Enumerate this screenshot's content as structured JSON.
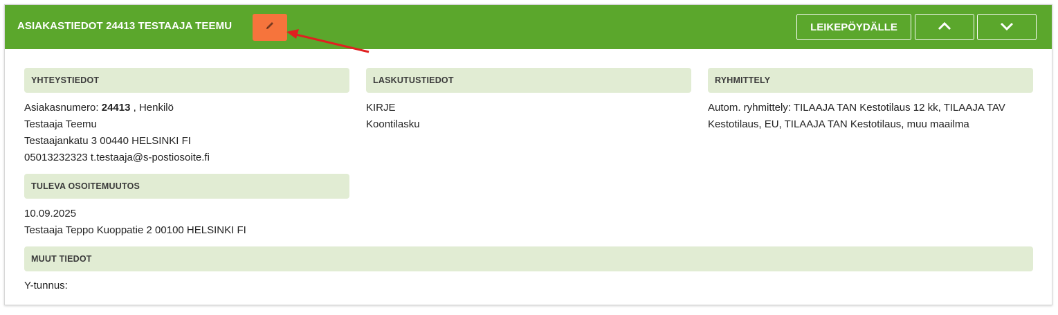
{
  "header": {
    "title": "ASIAKASTIEDOT 24413 TESTAAJA TEEMU",
    "clipboard_label": "LEIKEPÖYDÄLLE",
    "edit_icon": "pencil-icon",
    "up_icon": "chevron-up-icon",
    "down_icon": "chevron-down-icon",
    "color": "#5ba72c",
    "edit_color": "#f6743c"
  },
  "contact": {
    "heading": "YHTEYSTIEDOT",
    "customer_number_label": "Asiakasnumero:",
    "customer_number": "24413",
    "customer_type": ", Henkilö",
    "name": "Testaaja Teemu",
    "address": "Testaajankatu 3 00440 HELSINKI FI",
    "phone_email": "05013232323 t.testaaja@s-postiosoite.fi"
  },
  "billing": {
    "heading": "LASKUTUSTIEDOT",
    "lines": [
      "KIRJE",
      "Koontilasku"
    ]
  },
  "grouping": {
    "heading": "RYHMITTELY",
    "lines": [
      "Autom. ryhmittely: TILAAJA TAN Kestotilaus 12 kk, TILAAJA TAV",
      "Kestotilaus, EU, TILAAJA TAN Kestotilaus, muu maailma"
    ]
  },
  "address_change": {
    "heading": "TULEVA OSOITEMUUTOS",
    "date": "10.09.2025",
    "new_address": "Testaaja Teppo Kuoppatie 2 00100 HELSINKI FI"
  },
  "other": {
    "heading": "MUUT TIEDOT",
    "business_id_label": "Y-tunnus:"
  },
  "section_color": "#e1ecd3",
  "annotation_color": "#e02020"
}
